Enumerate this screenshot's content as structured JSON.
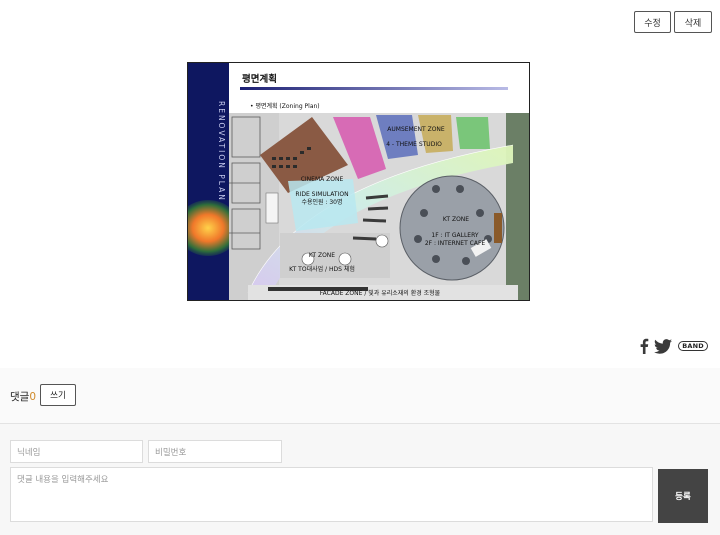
{
  "toolbar": {
    "edit_label": "수정",
    "delete_label": "삭제"
  },
  "slide": {
    "title": "평면계획",
    "bullet": "•   평면계획 (Zoning Plan)",
    "side_text": "RENOVATION PLAN",
    "zones": {
      "amusement": "AUMSEMENT ZONE",
      "theme_studio": "4 - THEME STUDIO",
      "cinema": "CINEMA ZONE",
      "ride_sim": "RIDE SIMULATION",
      "ride_capacity": "수용인원 : 30명",
      "kt_zone_right": "KT ZONE",
      "gallery": "1F : IT GALLERY",
      "internet_cafe": "2F : INTERNET CAFE",
      "kt_zone_left": "KT ZONE",
      "kt_business": "KT TO대사업 / HDS 체험",
      "facade": "FACADE ZONE / 빛과 유리소재의 환경 조형물"
    }
  },
  "share": {
    "facebook_icon": "facebook-icon",
    "twitter_icon": "twitter-icon",
    "band_label": "BAND"
  },
  "comments": {
    "title": "댓글",
    "count": "0",
    "write_label": "쓰기",
    "nickname_placeholder": "닉네임",
    "password_placeholder": "비밀번호",
    "content_placeholder": "댓글 내용을 입력해주세요",
    "submit_label": "등록"
  }
}
